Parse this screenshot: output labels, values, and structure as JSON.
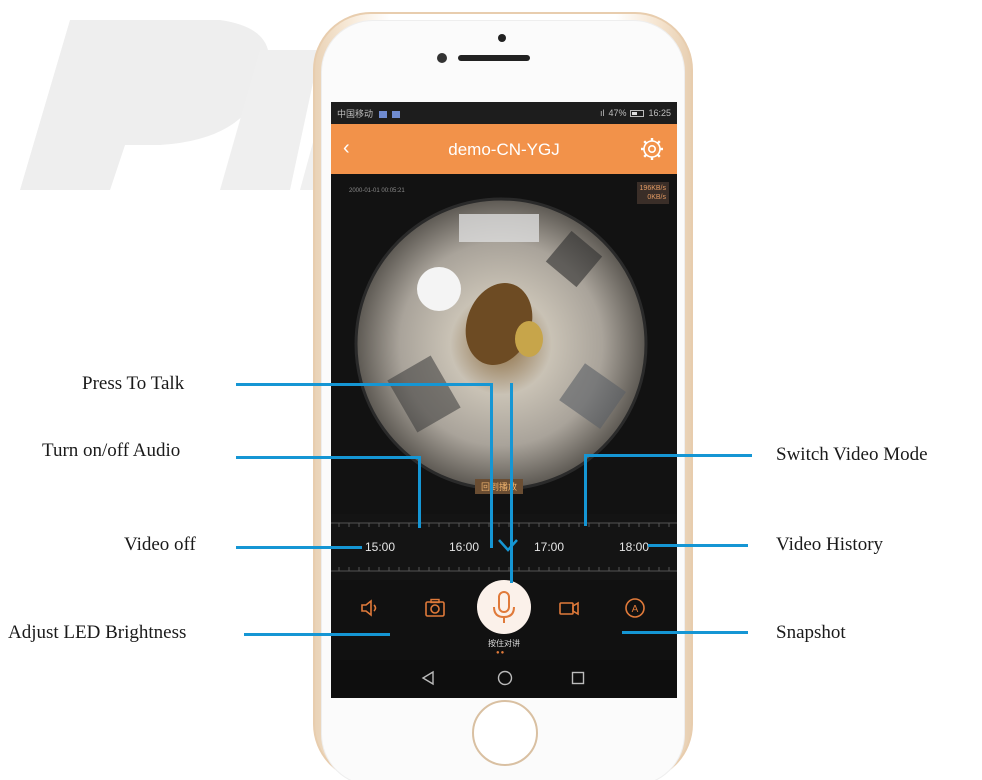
{
  "statusbar": {
    "carrier": "中国移动",
    "battery": "47%",
    "time": "16:25"
  },
  "appbar": {
    "back_icon": "chevron-left-icon",
    "title": "demo-CN-YGJ",
    "settings_icon": "gear-icon"
  },
  "video": {
    "timestamp": "2000-01-01 00:05:21",
    "rate_up": "196KB/s",
    "rate_down": "0KB/s",
    "playback_label": "回到播放"
  },
  "timeline": {
    "labels": [
      "15:00",
      "16:00",
      "17:00",
      "18:00"
    ]
  },
  "controls": {
    "audio_icon": "speaker-icon",
    "snapshot_icon": "camera-icon",
    "talk_icon": "microphone-icon",
    "talk_label": "按住对讲",
    "record_icon": "video-camera-icon",
    "mode_icon": "auto-mode-icon"
  },
  "navbar": {
    "back": "triangle-back-icon",
    "home": "circle-home-icon",
    "recent": "square-recent-icon"
  },
  "annotations": {
    "press_to_talk": "Press To Talk",
    "turn_audio": "Turn on/off Audio",
    "video_off": "Video off",
    "adjust_led": "Adjust LED Brightness",
    "switch_mode": "Switch Video Mode",
    "video_history": "Video History",
    "snapshot": "Snapshot"
  },
  "colors": {
    "accent": "#f2924a",
    "callout_line": "#1596d4",
    "screen_bg": "#131313"
  }
}
